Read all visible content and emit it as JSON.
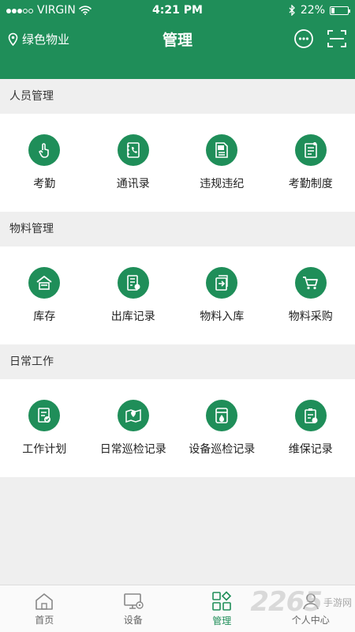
{
  "status_bar": {
    "carrier": "VIRGIN",
    "time": "4:21 PM",
    "battery": "22%",
    "battery_level": 0.22
  },
  "header": {
    "location": "绿色物业",
    "title": "管理",
    "icons": [
      "chat-bubble-icon",
      "scan-icon"
    ]
  },
  "sections": [
    {
      "title": "人员管理",
      "items": [
        {
          "label": "考勤",
          "icon": "tap-finger-icon"
        },
        {
          "label": "通讯录",
          "icon": "phonebook-icon"
        },
        {
          "label": "违规违纪",
          "icon": "penalty-icon"
        },
        {
          "label": "考勤制度",
          "icon": "policy-doc-icon"
        }
      ]
    },
    {
      "title": "物料管理",
      "items": [
        {
          "label": "库存",
          "icon": "warehouse-icon"
        },
        {
          "label": "出库记录",
          "icon": "outbound-record-icon"
        },
        {
          "label": "物料入库",
          "icon": "inbound-icon"
        },
        {
          "label": "物料采购",
          "icon": "cart-icon"
        }
      ]
    },
    {
      "title": "日常工作",
      "items": [
        {
          "label": "工作计划",
          "icon": "checklist-icon"
        },
        {
          "label": "日常巡检记录",
          "icon": "map-pin-icon"
        },
        {
          "label": "设备巡检记录",
          "icon": "equipment-icon"
        },
        {
          "label": "维保记录",
          "icon": "maintenance-clipboard-icon"
        }
      ]
    }
  ],
  "tabbar": [
    {
      "label": "首页",
      "icon": "home-icon"
    },
    {
      "label": "设备",
      "icon": "monitor-gear-icon"
    },
    {
      "label": "管理",
      "icon": "grid-diamond-icon",
      "active": true
    },
    {
      "label": "个人中心",
      "icon": "person-icon"
    }
  ],
  "watermark": {
    "number": "2265",
    "text": "手游网"
  },
  "colors": {
    "primary": "#1f8e59",
    "background": "#efefef"
  }
}
